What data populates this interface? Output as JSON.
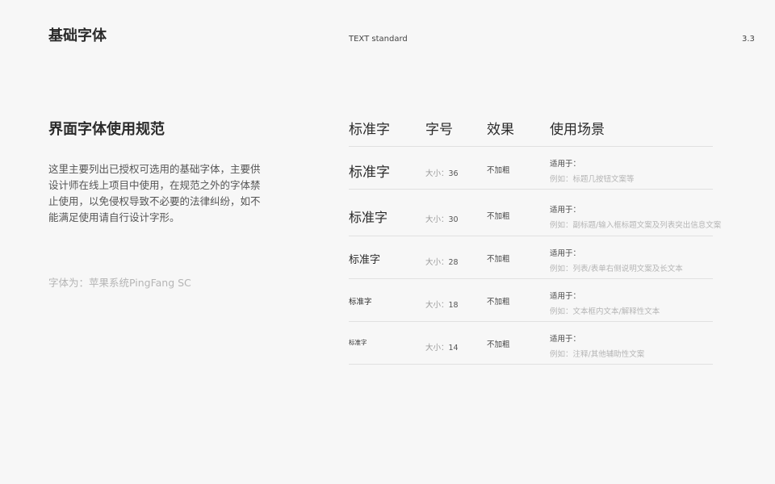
{
  "header": {
    "title": "基础字体",
    "subtitle": "TEXT standard",
    "page_number": "3.3"
  },
  "section": {
    "title": "界面字体使用规范",
    "description": "这里主要列出已授权可选用的基础字体，主要供设计师在线上项目中使用，在规范之外的字体禁止使用，以免侵权导致不必要的法律纠纷，如不能满足使用请自行设计字形。",
    "font_note": "字体为：苹果系统PingFang SC"
  },
  "table": {
    "columns": [
      "标准字",
      "字号",
      "效果",
      "使用场景"
    ],
    "size_prefix": "大小：",
    "rows": [
      {
        "sample": "标准字",
        "size": "36",
        "effect": "不加粗",
        "scene_head": "适用于：",
        "scene_example": "例如：标题几按钮文案等"
      },
      {
        "sample": "标准字",
        "size": "30",
        "effect": "不加粗",
        "scene_head": "适用于：",
        "scene_example": "例如：副标题/输入框标题文案及列表突出信息文案"
      },
      {
        "sample": "标准字",
        "size": "28",
        "effect": "不加粗",
        "scene_head": "适用于：",
        "scene_example": "例如：列表/表单右侧说明文案及长文本"
      },
      {
        "sample": "标准字",
        "size": "18",
        "effect": "不加粗",
        "scene_head": "适用于：",
        "scene_example": "例如：文本框内文本/解释性文本"
      },
      {
        "sample": "标准字",
        "size": "14",
        "effect": "不加粗",
        "scene_head": "适用于：",
        "scene_example": "例如：注释/其他辅助性文案"
      }
    ]
  }
}
